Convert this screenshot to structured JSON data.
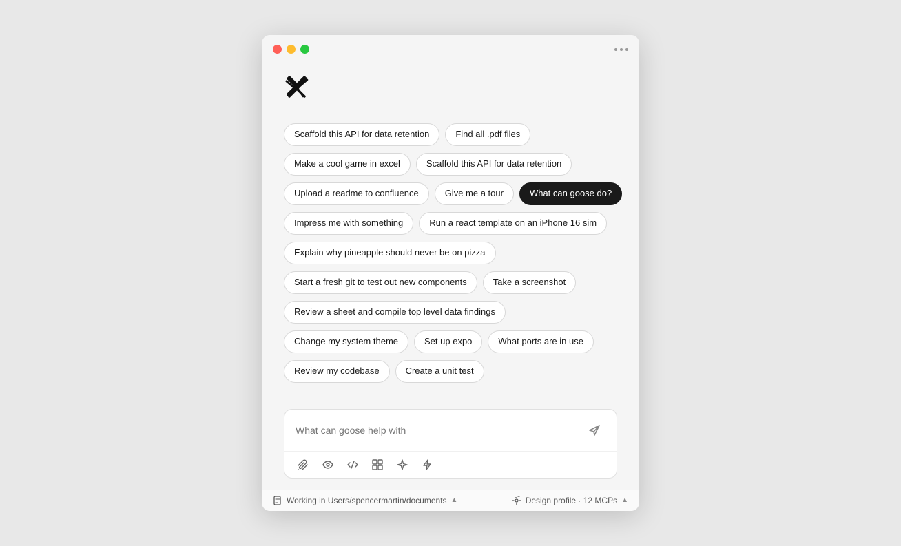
{
  "window": {
    "traffic_lights": [
      "red",
      "yellow",
      "green"
    ]
  },
  "chips": [
    [
      {
        "label": "Scaffold this API for data retention",
        "dark": false
      },
      {
        "label": "Find all .pdf files",
        "dark": false
      }
    ],
    [
      {
        "label": "Make a cool game in excel",
        "dark": false
      },
      {
        "label": "Scaffold this API for data retention",
        "dark": false
      }
    ],
    [
      {
        "label": "Upload a readme to confluence",
        "dark": false
      },
      {
        "label": "Give me a tour",
        "dark": false
      },
      {
        "label": "What can goose do?",
        "dark": true
      }
    ],
    [
      {
        "label": "Impress me with something",
        "dark": false
      },
      {
        "label": "Run a react template on an iPhone 16 sim",
        "dark": false
      }
    ],
    [
      {
        "label": "Explain why pineapple should never be on pizza",
        "dark": false
      }
    ],
    [
      {
        "label": "Start a fresh git to test out new components",
        "dark": false
      },
      {
        "label": "Take a screenshot",
        "dark": false
      }
    ],
    [
      {
        "label": "Review a sheet and compile top level data findings",
        "dark": false
      }
    ],
    [
      {
        "label": "Change my system theme",
        "dark": false
      },
      {
        "label": "Set up expo",
        "dark": false
      },
      {
        "label": "What ports are in use",
        "dark": false
      }
    ],
    [
      {
        "label": "Review my codebase",
        "dark": false
      },
      {
        "label": "Create a unit test",
        "dark": false
      }
    ]
  ],
  "input": {
    "placeholder": "What can goose help with"
  },
  "statusbar": {
    "left": "Working in Users/spencermartin/documents",
    "right": "Design profile · 12 MCPs"
  }
}
